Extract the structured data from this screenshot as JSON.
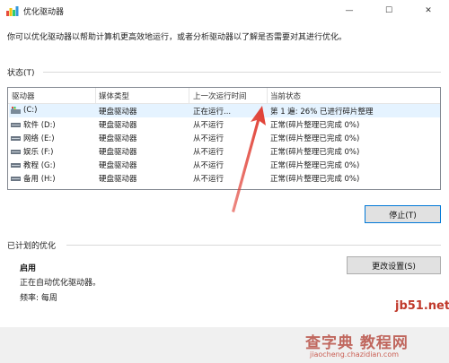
{
  "window": {
    "title": "优化驱动器",
    "controls": {
      "minimize": "—",
      "maximize": "☐",
      "close": "✕"
    }
  },
  "intro_text": "你可以优化驱动器以帮助计算机更高效地运行，或者分析驱动器以了解是否需要对其进行优化。",
  "status_section": {
    "label": "状态(T)",
    "columns": [
      "驱动器",
      "媒体类型",
      "上一次运行时间",
      "当前状态"
    ],
    "rows": [
      {
        "drive": "(C:)",
        "media": "硬盘驱动器",
        "last_run": "正在运行...",
        "status": "第 1 遍: 26% 已进行碎片整理",
        "selected": true,
        "icon": "system-drive-icon"
      },
      {
        "drive": "软件 (D:)",
        "media": "硬盘驱动器",
        "last_run": "从不运行",
        "status": "正常(碎片整理已完成 0%)",
        "selected": false,
        "icon": "drive-icon"
      },
      {
        "drive": "网络 (E:)",
        "media": "硬盘驱动器",
        "last_run": "从不运行",
        "status": "正常(碎片整理已完成 0%)",
        "selected": false,
        "icon": "drive-icon"
      },
      {
        "drive": "娱乐 (F:)",
        "media": "硬盘驱动器",
        "last_run": "从不运行",
        "status": "正常(碎片整理已完成 0%)",
        "selected": false,
        "icon": "drive-icon"
      },
      {
        "drive": "教程 (G:)",
        "media": "硬盘驱动器",
        "last_run": "从不运行",
        "status": "正常(碎片整理已完成 0%)",
        "selected": false,
        "icon": "drive-icon"
      },
      {
        "drive": "备用 (H:)",
        "media": "硬盘驱动器",
        "last_run": "从不运行",
        "status": "正常(碎片整理已完成 0%)",
        "selected": false,
        "icon": "drive-icon"
      }
    ],
    "stop_button": "停止(T)"
  },
  "scheduled_section": {
    "label": "已计划的优化",
    "state": "启用",
    "detail": "正在自动优化驱动器。",
    "frequency": "频率: 每周",
    "change_button": "更改设置(S)"
  },
  "watermarks": {
    "site": "jb51.net",
    "cn": "查字典 教程网",
    "url": "jiaocheng.chazidian.com"
  },
  "colors": {
    "selected_row": "#e5f3ff",
    "annotation_arrow": "#e03c31",
    "focus_border": "#0078d7"
  }
}
